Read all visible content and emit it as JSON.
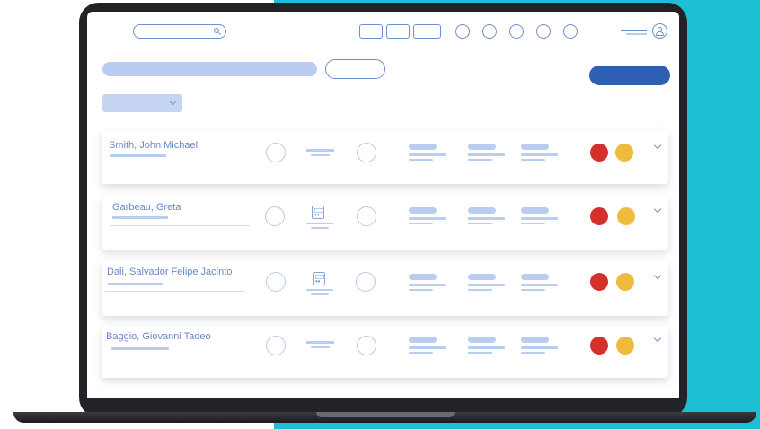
{
  "colors": {
    "teal_bg": "#1cbfd3",
    "primary_button": "#2f5fb3",
    "accent_outline": "#6c8fcf",
    "placeholder": "#b9cdf0",
    "status_red": "#d5302c",
    "status_yellow": "#efbb3e"
  },
  "header": {
    "search_icon": "search-icon",
    "account_icon": "user-icon"
  },
  "patients": [
    {
      "name": "Smith, John Michael",
      "device": false
    },
    {
      "name": "Garbeau, Greta",
      "device": true
    },
    {
      "name": "Dali, Salvador Felipe Jacinto",
      "device": true
    },
    {
      "name": "Baggio, Giovanni Tadeo",
      "device": false
    }
  ]
}
